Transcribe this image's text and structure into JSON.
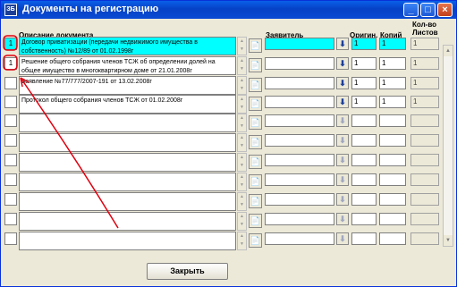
{
  "window": {
    "title": "Документы на регистрацию",
    "icon_name": "app-icon",
    "icon_text": "ЗБ",
    "minimize": "_",
    "maximize": "□",
    "close": "×"
  },
  "headers": {
    "description": "Описание документа",
    "applicant": "Заявитель",
    "original": "Оригин.",
    "copies": "Копий",
    "sheets_line1": "Кол-во",
    "sheets_line2": "Листов"
  },
  "rows": [
    {
      "checkbox": "1",
      "description": "Договор приватизации (передачи недвижимого имущества в собственность) №12/89 от 01.02.1998г",
      "applicant": "",
      "original": "1",
      "copies": "1",
      "sheets": "1",
      "highlighted": true
    },
    {
      "checkbox": "1",
      "description": "Решение общего собрания членов ТСЖ об определении долей на общее имущество в многоквартирном доме от 21.01.2008г",
      "applicant": "",
      "original": "1",
      "copies": "1",
      "sheets": "1",
      "highlighted": false
    },
    {
      "checkbox": "",
      "description": "Заявление №77/777/2007-191 от 13.02.2008г",
      "applicant": "",
      "original": "1",
      "copies": "1",
      "sheets": "1",
      "highlighted": false
    },
    {
      "checkbox": "",
      "description": "Протокол общего собрания членов ТСЖ от 01.02.2008г",
      "applicant": "",
      "original": "1",
      "copies": "1",
      "sheets": "1",
      "highlighted": false
    },
    {
      "checkbox": "",
      "description": "",
      "applicant": "",
      "original": "",
      "copies": "",
      "sheets": "",
      "highlighted": false
    },
    {
      "checkbox": "",
      "description": "",
      "applicant": "",
      "original": "",
      "copies": "",
      "sheets": "",
      "highlighted": false
    },
    {
      "checkbox": "",
      "description": "",
      "applicant": "",
      "original": "",
      "copies": "",
      "sheets": "",
      "highlighted": false
    },
    {
      "checkbox": "",
      "description": "",
      "applicant": "",
      "original": "",
      "copies": "",
      "sheets": "",
      "highlighted": false
    },
    {
      "checkbox": "",
      "description": "",
      "applicant": "",
      "original": "",
      "copies": "",
      "sheets": "",
      "highlighted": false
    },
    {
      "checkbox": "",
      "description": "",
      "applicant": "",
      "original": "",
      "copies": "",
      "sheets": "",
      "highlighted": false
    },
    {
      "checkbox": "",
      "description": "",
      "applicant": "",
      "original": "",
      "copies": "",
      "sheets": "",
      "highlighted": false
    }
  ],
  "icons": {
    "doc_button": "📄",
    "download_button": "⬇",
    "scroll_up": "▲",
    "scroll_down": "▼"
  },
  "footer": {
    "close_label": "Закрыть"
  },
  "colors": {
    "highlight": "#00ffff",
    "annotation": "#e0000f",
    "title_bar": "#0a5fe8"
  }
}
